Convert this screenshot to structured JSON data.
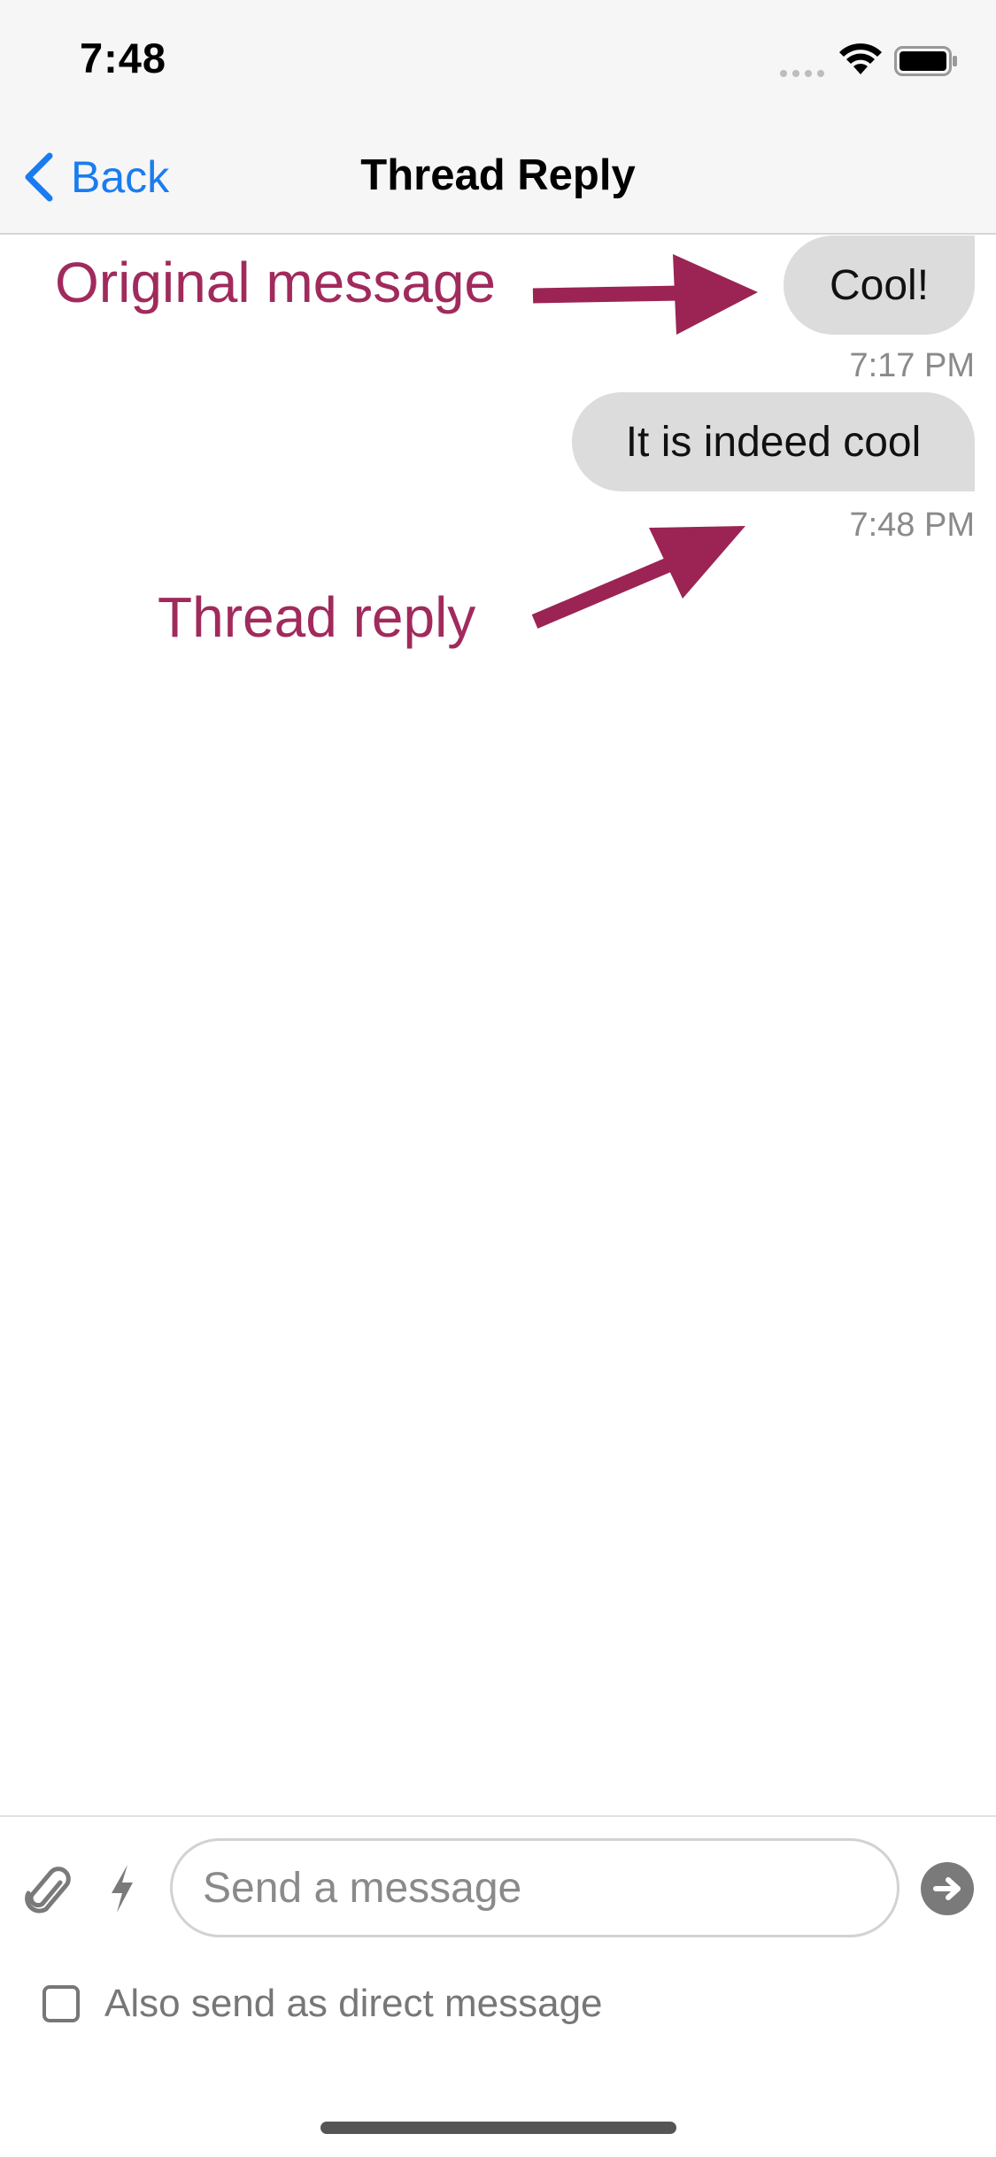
{
  "status_bar": {
    "time": "7:48"
  },
  "nav": {
    "back_label": "Back",
    "title": "Thread Reply"
  },
  "messages": [
    {
      "text": "Cool!",
      "time": "7:17 PM"
    },
    {
      "text": "It is indeed cool",
      "time": "7:48 PM"
    }
  ],
  "annotations": {
    "original": "Original message",
    "thread": "Thread reply",
    "color": "#a12a5c"
  },
  "composer": {
    "placeholder": "Send a message",
    "value": "",
    "dm_label": "Also send as direct message",
    "dm_checked": false
  },
  "colors": {
    "accent": "#1a7cf0",
    "bubble": "#dcdcdc",
    "annotation": "#a12a5c"
  },
  "icons": [
    "chevron-left-icon",
    "signal-icon",
    "wifi-icon",
    "battery-icon",
    "paperclip-icon",
    "lightning-icon",
    "arrow-right-icon"
  ]
}
